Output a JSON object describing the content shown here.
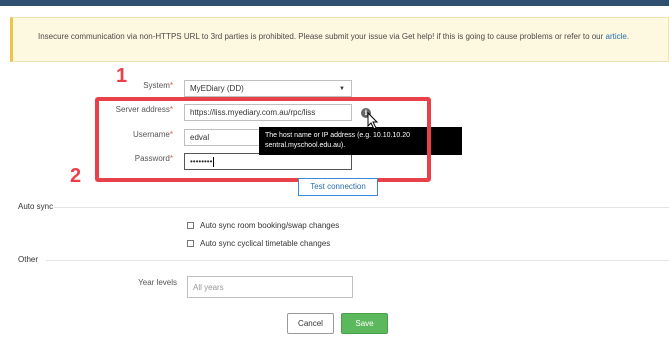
{
  "alert": {
    "text": "Insecure communication via non-HTTPS URL to 3rd parties is prohibited. Please submit your issue via Get help! if this is going to cause problems or refer to our",
    "link": "article",
    "after_link": "."
  },
  "form": {
    "system": {
      "label": "System",
      "required": "*",
      "value": "MyEDiary (DD)"
    },
    "server_address": {
      "label": "Server address",
      "required": "*",
      "value": "https://liss.myediary.com.au/rpc/liss"
    },
    "username": {
      "label": "Username",
      "required": "*",
      "value": "edval"
    },
    "password": {
      "label": "Password",
      "required": "*",
      "value": "••••••••"
    },
    "tooltip": "The host name or IP address (e.g. 10.10.10.20 sentral.myschool.edu.au).",
    "test_connection_label": "Test connection"
  },
  "annotations": {
    "num1": "1",
    "num2": "2",
    "color": "#e8414a"
  },
  "auto_sync": {
    "title": "Auto sync",
    "options": [
      {
        "label": "Auto sync room booking/swap changes",
        "checked": false
      },
      {
        "label": "Auto sync cyclical timetable changes",
        "checked": false
      }
    ]
  },
  "other": {
    "title": "Other",
    "year_levels_label": "Year levels",
    "year_levels_placeholder": "All years"
  },
  "actions": {
    "cancel": "Cancel",
    "save": "Save",
    "save_color": "#5cb85c"
  },
  "icons": {
    "info": "info-icon",
    "cursor": "mouse-pointer-icon",
    "dropdown": "chevron-down-icon"
  }
}
